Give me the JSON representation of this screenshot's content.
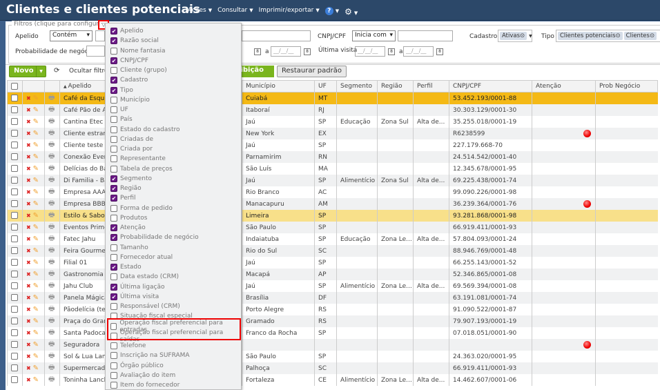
{
  "header": {
    "title": "Clientes e clientes potenciais",
    "menus": [
      "Ações",
      "Consultar",
      "Imprimir/exportar"
    ],
    "help": "?"
  },
  "filters": {
    "legend": "Filtros (clique para configurar:",
    "apelido_label": "Apelido",
    "apelido_op": "Contém",
    "cnpj_label": "CNPJ/CPF",
    "cnpj_op": "Inicia com",
    "cadastro_label": "Cadastro",
    "cadastro_tags": [
      "Ativas⊙"
    ],
    "tipo_label": "Tipo",
    "tipo_tags": [
      "Clientes potenciais⊙",
      "Clientes⊙"
    ],
    "prob_label": "Probabilidade de negócio",
    "ultima_visita_label": "Última visita",
    "date_placeholder": "__/__/__",
    "a": "a"
  },
  "toolbar": {
    "novo": "Novo",
    "ocultar": "Ocultar filtros",
    "exibicao": "xibição",
    "restaurar": "Restaurar padrão"
  },
  "table": {
    "columns": [
      "Apelido",
      "Município",
      "UF",
      "Segmento",
      "Região",
      "Perfil",
      "CNPJ/CPF",
      "Atenção",
      "Prob Negócio"
    ],
    "rows": [
      [
        "Café da Esquina",
        "Cuiabá",
        "MT",
        "",
        "",
        "",
        "53.452.193/0001-88",
        false
      ],
      [
        "Café Pão de Açúcar",
        "Itaboraí",
        "RJ",
        "",
        "",
        "",
        "30.303.129/0001-30",
        false
      ],
      [
        "Cantina Etec",
        "Jaú",
        "SP",
        "Educação",
        "Zona Sul",
        "Alta de...",
        "35.255.018/0001-19",
        false
      ],
      [
        "Cliente estrangeiro",
        "New York",
        "EX",
        "",
        "",
        "",
        "R6238599",
        true
      ],
      [
        "Cliente teste Bi",
        "Jaú",
        "SP",
        "",
        "",
        "",
        "227.179.668-70",
        false
      ],
      [
        "Conexão Eventos",
        "Parnamirim",
        "RN",
        "",
        "",
        "",
        "24.514.542/0001-40",
        false
      ],
      [
        "Delícias do Bairro",
        "São Luís",
        "MA",
        "",
        "",
        "",
        "12.345.678/0001-95",
        false
      ],
      [
        "Di Familia - Bar",
        "Jaú",
        "SP",
        "Alimentício",
        "Zona Sul",
        "Alta de...",
        "69.225.438/0001-74",
        false
      ],
      [
        "Empresa AAAA",
        "Rio Branco",
        "AC",
        "",
        "",
        "",
        "99.090.226/0001-98",
        false
      ],
      [
        "Empresa BBBB",
        "Manacapuru",
        "AM",
        "",
        "",
        "",
        "36.239.364/0001-76",
        true
      ],
      [
        "Estilo & Sabor",
        "Limeira",
        "SP",
        "",
        "",
        "",
        "93.281.868/0001-98",
        false
      ],
      [
        "Eventos Prime",
        "São Paulo",
        "SP",
        "",
        "",
        "",
        "66.919.411/0001-93",
        false
      ],
      [
        "Fatec Jahu",
        "Indaiatuba",
        "SP",
        "Educação",
        "Zona Le...",
        "Alta de...",
        "57.804.093/0001-24",
        false
      ],
      [
        "Feira Gourmet",
        "Rio do Sul",
        "SC",
        "",
        "",
        "",
        "88.946.769/0001-48",
        false
      ],
      [
        "Filial 01",
        "Jaú",
        "SP",
        "",
        "",
        "",
        "66.255.143/0001-52",
        false
      ],
      [
        "Gastronomia G",
        "Macapá",
        "AP",
        "",
        "",
        "",
        "52.346.865/0001-08",
        false
      ],
      [
        "Jahu Club",
        "Jaú",
        "SP",
        "Alimentício",
        "Zona Le...",
        "Alta de...",
        "69.569.394/0001-08",
        false
      ],
      [
        "Panela Mágica",
        "Brasília",
        "DF",
        "",
        "",
        "",
        "63.191.081/0001-74",
        false
      ],
      [
        "Pãodelícia (teste)",
        "Porto Alegre",
        "RS",
        "",
        "",
        "",
        "91.090.522/0001-87",
        false
      ],
      [
        "Praça do Grama",
        "Gramado",
        "RS",
        "",
        "",
        "",
        "79.907.193/0001-19",
        false
      ],
      [
        "Santa Padoca",
        "Franco da Rocha",
        "SP",
        "",
        "",
        "",
        "07.018.051/0001-90",
        false
      ],
      [
        "Seguradora",
        "",
        "",
        "",
        "",
        "",
        "",
        true
      ],
      [
        "Sol & Lua Lanches",
        "São Paulo",
        "SP",
        "",
        "",
        "",
        "24.363.020/0001-95",
        false
      ],
      [
        "Supermercado",
        "Palhoça",
        "SC",
        "",
        "",
        "",
        "66.919.411/0001-93",
        false
      ],
      [
        "Toninha Lanches",
        "Fortaleza",
        "CE",
        "Alimentício",
        "Zona Le...",
        "Alta de...",
        "14.462.607/0001-06",
        false
      ]
    ]
  },
  "column_picker": [
    {
      "label": "Apelido",
      "checked": true
    },
    {
      "label": "Razão social",
      "checked": true
    },
    {
      "label": "Nome fantasia",
      "checked": false
    },
    {
      "label": "CNPJ/CPF",
      "checked": true
    },
    {
      "label": "Cliente (grupo)",
      "checked": false
    },
    {
      "label": "Cadastro",
      "checked": true
    },
    {
      "label": "Tipo",
      "checked": true
    },
    {
      "label": "Município",
      "checked": false
    },
    {
      "label": "UF",
      "checked": false
    },
    {
      "label": "País",
      "checked": false
    },
    {
      "label": "Estado do cadastro",
      "checked": false
    },
    {
      "label": "Criadas de",
      "checked": false
    },
    {
      "label": "Criada por",
      "checked": false
    },
    {
      "label": "Representante",
      "checked": false
    },
    {
      "label": "Tabela de preços",
      "checked": false
    },
    {
      "label": "Segmento",
      "checked": true
    },
    {
      "label": "Região",
      "checked": true
    },
    {
      "label": "Perfil",
      "checked": true
    },
    {
      "label": "Forma de pedido",
      "checked": false
    },
    {
      "label": "Produtos",
      "checked": false
    },
    {
      "label": "Atenção",
      "checked": true
    },
    {
      "label": "Probabilidade de negócio",
      "checked": true
    },
    {
      "label": "Tamanho",
      "checked": false
    },
    {
      "label": "Fornecedor atual",
      "checked": false
    },
    {
      "label": "Estado",
      "checked": true
    },
    {
      "label": "Data estado (CRM)",
      "checked": false
    },
    {
      "label": "Última ligação",
      "checked": true
    },
    {
      "label": "Última visita",
      "checked": true
    },
    {
      "label": "Responsável (CRM)",
      "checked": false
    },
    {
      "label": "Situação fiscal especial",
      "checked": false
    },
    {
      "label": "Operação fiscal preferencial para entradas",
      "checked": false
    },
    {
      "label": "Operação fiscal preferencial para saídas",
      "checked": false
    },
    {
      "label": "Telefone",
      "checked": false
    },
    {
      "label": "Inscrição na SUFRAMA",
      "checked": false
    },
    {
      "label": "Órgão público",
      "checked": false
    },
    {
      "label": "Avaliação do item",
      "checked": false
    },
    {
      "label": "Item do fornecedor",
      "checked": false
    }
  ]
}
